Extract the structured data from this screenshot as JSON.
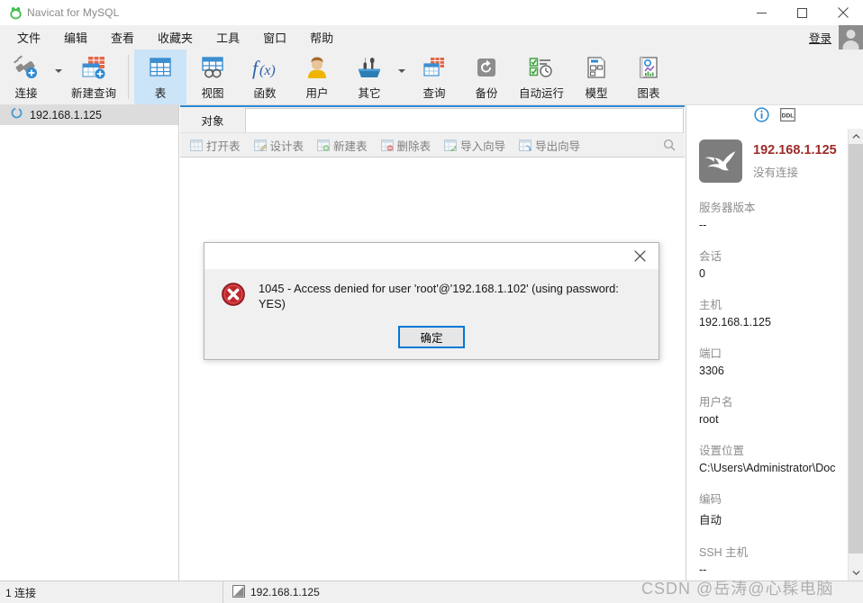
{
  "window": {
    "app_title": "Navicat for MySQL",
    "logo_icon": "navicat-logo-icon",
    "minimize_icon": "minimize-icon",
    "maximize_icon": "maximize-icon",
    "close_icon": "close-icon"
  },
  "menubar": {
    "items": [
      {
        "label": "文件",
        "name": "menu-file"
      },
      {
        "label": "编辑",
        "name": "menu-edit"
      },
      {
        "label": "查看",
        "name": "menu-view"
      },
      {
        "label": "收藏夹",
        "name": "menu-favorites"
      },
      {
        "label": "工具",
        "name": "menu-tools"
      },
      {
        "label": "窗口",
        "name": "menu-window"
      },
      {
        "label": "帮助",
        "name": "menu-help"
      }
    ],
    "login_label": "登录",
    "avatar_icon": "user-avatar-icon"
  },
  "toolbar": {
    "buttons": [
      {
        "label": "连接",
        "icon": "connection-plug-icon",
        "name": "toolbar-connection",
        "active": false,
        "caret": true
      },
      {
        "label": "新建查询",
        "icon": "new-query-icon",
        "name": "toolbar-new-query",
        "active": false,
        "caret": false
      },
      {
        "label": "表",
        "icon": "table-icon",
        "name": "toolbar-table",
        "active": true,
        "caret": false
      },
      {
        "label": "视图",
        "icon": "view-icon",
        "name": "toolbar-view",
        "active": false,
        "caret": false
      },
      {
        "label": "函数",
        "icon": "function-fx-icon",
        "name": "toolbar-function",
        "active": false,
        "caret": false
      },
      {
        "label": "用户",
        "icon": "user-icon",
        "name": "toolbar-user",
        "active": false,
        "caret": false
      },
      {
        "label": "其它",
        "icon": "other-tools-icon",
        "name": "toolbar-other",
        "active": false,
        "caret": true
      },
      {
        "label": "查询",
        "icon": "query-icon",
        "name": "toolbar-query",
        "active": false,
        "caret": false
      },
      {
        "label": "备份",
        "icon": "backup-icon",
        "name": "toolbar-backup",
        "active": false,
        "caret": false
      },
      {
        "label": "自动运行",
        "icon": "automation-icon",
        "name": "toolbar-automation",
        "active": false,
        "caret": false
      },
      {
        "label": "模型",
        "icon": "model-icon",
        "name": "toolbar-model",
        "active": false,
        "caret": false
      },
      {
        "label": "图表",
        "icon": "chart-icon",
        "name": "toolbar-chart",
        "active": false,
        "caret": false
      }
    ]
  },
  "sidebar": {
    "connections": [
      {
        "label": "192.168.1.125",
        "icon": "connection-circle-icon",
        "selected": true
      }
    ]
  },
  "center": {
    "tab_label": "对象",
    "object_buttons": [
      {
        "label": "打开表",
        "icon": "open-table-icon",
        "name": "open-table-button"
      },
      {
        "label": "设计表",
        "icon": "design-table-icon",
        "name": "design-table-button"
      },
      {
        "label": "新建表",
        "icon": "new-table-icon",
        "name": "new-table-button"
      },
      {
        "label": "删除表",
        "icon": "delete-table-icon",
        "name": "delete-table-button"
      },
      {
        "label": "导入向导",
        "icon": "import-wizard-icon",
        "name": "import-wizard-button"
      },
      {
        "label": "导出向导",
        "icon": "export-wizard-icon",
        "name": "export-wizard-button"
      }
    ],
    "search_icon": "search-icon"
  },
  "right_panel": {
    "info_icon": "info-circle-icon",
    "ddl_icon": "ddl-icon",
    "db_icon": "mysql-dolphin-icon",
    "title": "192.168.1.125",
    "subtitle": "没有连接",
    "fields": [
      {
        "key": "服务器版本",
        "value": "--"
      },
      {
        "key": "会话",
        "value": "0"
      },
      {
        "key": "主机",
        "value": "192.168.1.125"
      },
      {
        "key": "端口",
        "value": "3306"
      },
      {
        "key": "用户名",
        "value": "root"
      },
      {
        "key": "设置位置",
        "value": "C:\\Users\\Administrator\\Doc"
      },
      {
        "key": "编码",
        "value": "自动"
      },
      {
        "key": "SSH 主机",
        "value": "--"
      }
    ],
    "scroll_up_icon": "chevron-up-icon",
    "scroll_down_icon": "chevron-down-icon"
  },
  "statusbar": {
    "connections_text": "1 连接",
    "host_icon": "host-icon",
    "host_text": "192.168.1.125"
  },
  "dialog": {
    "close_icon": "close-icon",
    "error_icon": "error-icon",
    "message": "1045 - Access denied for user 'root'@'192.168.1.102' (using password: YES)",
    "ok_label": "确定"
  },
  "watermark": {
    "text": "CSDN @岳涛@心髹电脑"
  },
  "colors": {
    "accent": "#2d8ad4",
    "active_tool_bg": "#cce4f7",
    "chrome_bg": "#f0f0f0",
    "error_red": "#c0282d",
    "title_red": "#9e2a2a",
    "focus_blue": "#0078d7"
  }
}
